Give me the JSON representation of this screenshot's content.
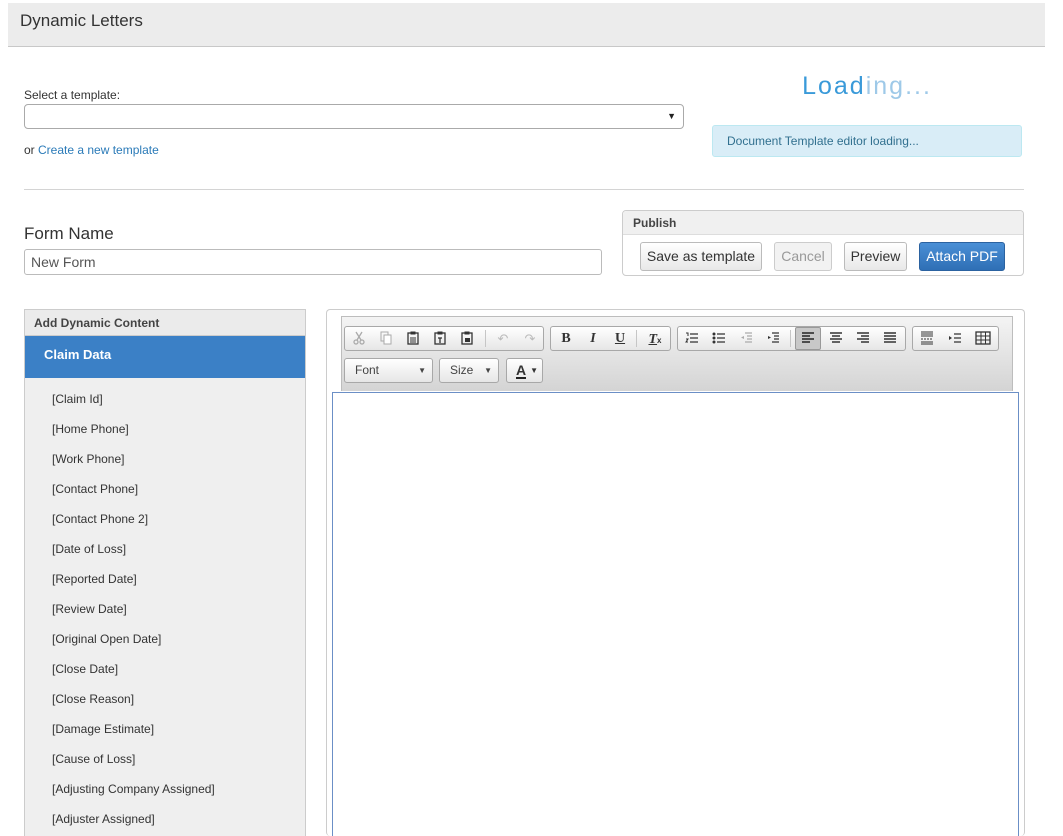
{
  "app": {
    "title": "Dynamic Letters"
  },
  "template": {
    "select_label": "Select a template:",
    "selected_value": "",
    "or_text": "or",
    "create_link": "Create a new template"
  },
  "loading": {
    "text_main": "Load",
    "text_dim": "ing...",
    "alert": "Document Template editor loading..."
  },
  "form": {
    "name_label": "Form Name",
    "name_value": "New Form"
  },
  "publish": {
    "title": "Publish",
    "buttons": {
      "save_template": "Save as template",
      "cancel": "Cancel",
      "preview": "Preview",
      "attach_pdf": "Attach PDF"
    }
  },
  "dynamic_content": {
    "title": "Add Dynamic Content",
    "section": "Claim Data",
    "items": [
      "[Claim Id]",
      "[Home Phone]",
      "[Work Phone]",
      "[Contact Phone]",
      "[Contact Phone 2]",
      "[Date of Loss]",
      "[Reported Date]",
      "[Review Date]",
      "[Original Open Date]",
      "[Close Date]",
      "[Close Reason]",
      "[Damage Estimate]",
      "[Cause of Loss]",
      "[Adjusting Company Assigned]",
      "[Adjuster Assigned]"
    ]
  },
  "toolbar": {
    "font_label": "Font",
    "size_label": "Size",
    "text_color_label": "A",
    "bold_label": "B",
    "italic_label": "I",
    "underline_label": "U",
    "icons": [
      "cut-icon",
      "copy-icon",
      "paste-icon",
      "paste-text-icon",
      "paste-word-icon",
      "undo-icon",
      "redo-icon",
      "bold-icon",
      "italic-icon",
      "underline-icon",
      "remove-format-icon",
      "numbered-list-icon",
      "bullet-list-icon",
      "decrease-indent-icon",
      "increase-indent-icon",
      "align-left-icon",
      "align-center-icon",
      "align-right-icon",
      "justify-icon",
      "page-break-icon",
      "insert-indent-icon",
      "table-icon"
    ]
  },
  "colors": {
    "accent": "#3b80c6",
    "primary_button": "#2f6fb5",
    "loading_text": "#3a9ad9",
    "alert_bg": "#d9edf7"
  }
}
